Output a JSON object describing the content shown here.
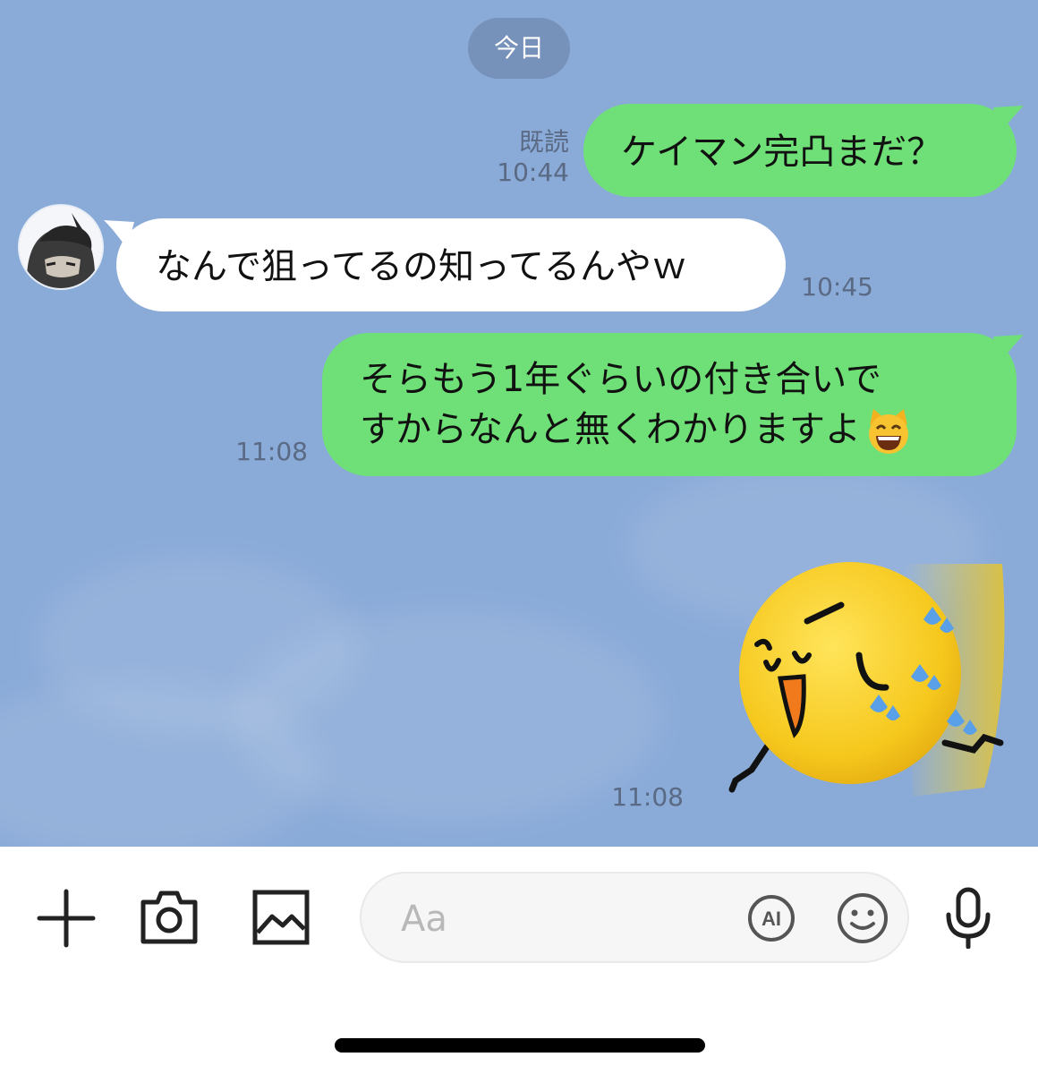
{
  "chat": {
    "date_label": "今日",
    "messages": [
      {
        "side": "mine",
        "text": "ケイマン完凸まだ？",
        "read": "既読",
        "time": "10:44"
      },
      {
        "side": "theirs",
        "text": "なんで狙ってるの知ってるんやｗ",
        "time": "10:45"
      },
      {
        "side": "mine",
        "line1": "そらもう1年ぐらいの付き合いで",
        "line2": "すからなんと無くわかりますよ",
        "emoji": "grinning-cat-emoji",
        "time": "11:08"
      },
      {
        "side": "mine",
        "type": "sticker",
        "sticker": "running-yellow-face-sticker",
        "time": "11:08"
      }
    ]
  },
  "input_bar": {
    "placeholder": "Aa",
    "icons": [
      "plus-icon",
      "camera-icon",
      "image-icon",
      "ai-icon",
      "emoji-icon",
      "microphone-icon"
    ],
    "ai_label": "AI"
  },
  "colors": {
    "chat_background": "#8aaad8",
    "my_bubble": "#6fe077",
    "their_bubble": "#ffffff",
    "date_pill": "#7792ba"
  }
}
